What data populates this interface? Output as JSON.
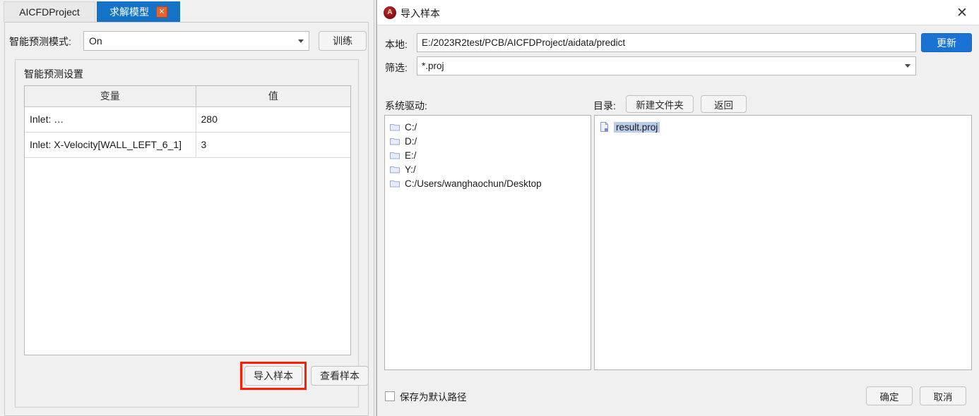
{
  "left_panel": {
    "tabs": [
      {
        "label": "AICFDProject",
        "active": false,
        "closable": false
      },
      {
        "label": "求解模型",
        "active": true,
        "closable": true,
        "close_icon": "close-icon",
        "close_glyph": "✕"
      }
    ],
    "mode_row": {
      "label": "智能预测模式:",
      "value": "On",
      "arrow_icon": "chevron-down-icon",
      "train_label": "训练"
    },
    "groupbox": {
      "title": "智能预测设置",
      "table": {
        "columns": [
          "变量",
          "值"
        ],
        "rows": [
          {
            "variable": "Inlet: …",
            "value": "280"
          },
          {
            "variable": "Inlet: X-Velocity[WALL_LEFT_6_1]",
            "value": "3"
          }
        ]
      },
      "buttons": {
        "import_sample": "导入样本",
        "view_sample": "查看样本"
      },
      "highlight_color": "#ff1f00"
    }
  },
  "dialog": {
    "title": "导入样本",
    "app_icon": "app-logo-icon",
    "app_icon_glyph": "A",
    "close_icon": "close-icon",
    "close_glyph": "✕",
    "local": {
      "label": "本地:",
      "value": "E:/2023R2test/PCB/AICFDProject/aidata/predict",
      "update_label": "更新",
      "update_color": "#1a73d4"
    },
    "filter": {
      "label": "筛选:",
      "value": "*.proj",
      "arrow_icon": "chevron-down-icon"
    },
    "drives": {
      "label": "系统驱动:",
      "items": [
        {
          "name": "C:/",
          "icon": "folder-icon"
        },
        {
          "name": "D:/",
          "icon": "folder-icon"
        },
        {
          "name": "E:/",
          "icon": "folder-icon"
        },
        {
          "name": "Y:/",
          "icon": "folder-icon"
        },
        {
          "name": "C:/Users/wanghaochun/Desktop",
          "icon": "folder-icon"
        }
      ]
    },
    "directory": {
      "label": "目录:",
      "new_folder_label": "新建文件夹",
      "back_label": "返回",
      "files": [
        {
          "name": "result.proj",
          "icon": "file-icon",
          "selected": true
        }
      ]
    },
    "footer": {
      "checkbox_label": "保存为默认路径",
      "checkbox_checked": false,
      "ok_label": "确定",
      "cancel_label": "取消"
    }
  }
}
